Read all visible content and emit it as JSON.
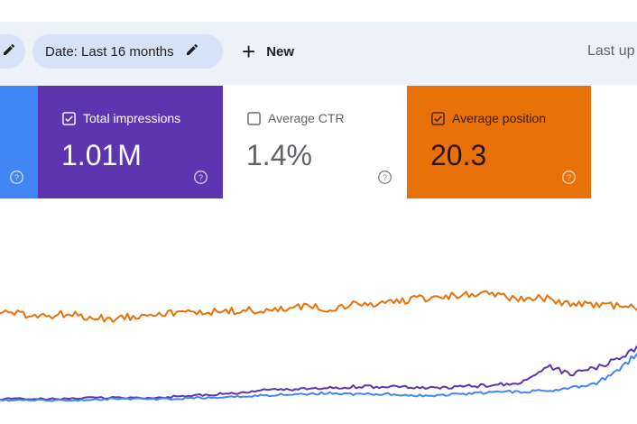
{
  "filter_bar": {
    "date_chip_label": "Date: Last 16 months",
    "new_label": "New",
    "last_updated_text": "Last up"
  },
  "metrics": {
    "impressions": {
      "label": "Total impressions",
      "value": "1.01M",
      "checked": true,
      "color": "#5e35b1"
    },
    "ctr": {
      "label": "Average CTR",
      "value": "1.4%",
      "checked": false,
      "color": "#ffffff"
    },
    "position": {
      "label": "Average position",
      "value": "20.3",
      "checked": true,
      "color": "#e8710a"
    },
    "clicks": {
      "color": "#4285f4"
    }
  },
  "icons": [
    "pencil-icon",
    "plus-icon",
    "checkbox-icon",
    "help-icon"
  ],
  "chart_data": {
    "type": "line",
    "series": [
      {
        "color": "#e8710a",
        "values": [
          74,
          71,
          70,
          72,
          69,
          68,
          70,
          73,
          72,
          74,
          73,
          75,
          74,
          76,
          78,
          76,
          79,
          80,
          82,
          84,
          86,
          87,
          88,
          86,
          85,
          84,
          80,
          79,
          78,
          77
        ]
      },
      {
        "color": "#5e35b1",
        "values": [
          2,
          2,
          2,
          2,
          3,
          3,
          3,
          3,
          4,
          5,
          6,
          7,
          9,
          10,
          10,
          11,
          12,
          12,
          12,
          11,
          11,
          12,
          13,
          14,
          17,
          29,
          22,
          27,
          34,
          44
        ]
      },
      {
        "color": "#4285f4",
        "values": [
          1,
          1,
          1,
          1,
          1,
          2,
          2,
          2,
          2,
          3,
          3,
          4,
          5,
          6,
          6,
          7,
          6,
          6,
          6,
          5,
          5,
          6,
          7,
          8,
          8,
          9,
          12,
          14,
          23,
          39
        ]
      }
    ]
  }
}
